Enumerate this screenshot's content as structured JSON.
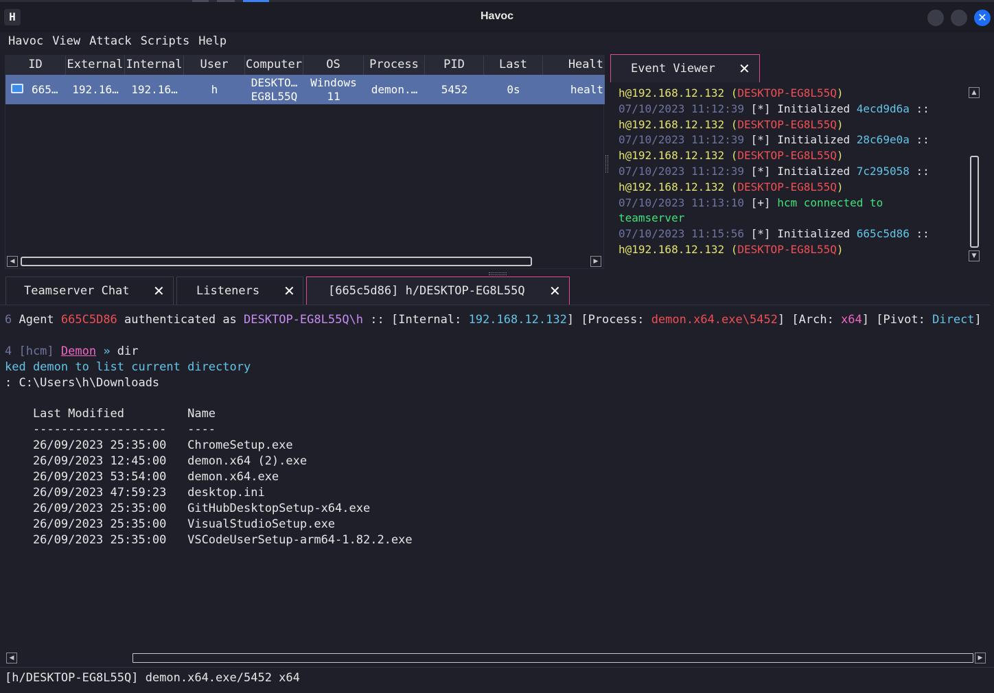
{
  "window": {
    "title": "Havoc",
    "app_icon_glyph": "H"
  },
  "menu": [
    "Havoc",
    "View",
    "Attack",
    "Scripts",
    "Help"
  ],
  "sessions_table": {
    "columns": [
      "ID",
      "External",
      "Internal",
      "User",
      "Computer",
      "OS",
      "Process",
      "PID",
      "Last",
      "Healt"
    ],
    "rows": [
      {
        "id": "665…",
        "external": "192.16…",
        "internal": "192.16…",
        "user": "h",
        "computer_line1": "DESKTO…",
        "computer_line2": "EG8L55Q",
        "os_line1": "Windows",
        "os_line2": "11",
        "process": "demon.…",
        "pid": "5452",
        "last": "0s",
        "health": "healt"
      }
    ],
    "row_selected_color": "#566fa6"
  },
  "event_viewer": {
    "tab_label": "Event Viewer",
    "lines": [
      [
        {
          "t": "h@192.168.12.132 (",
          "c": "y"
        },
        {
          "t": "DESKTOP-EG8L55Q",
          "c": "r"
        },
        {
          "t": ")",
          "c": "y"
        }
      ],
      [
        {
          "t": "07/10/2023 11:12:39 ",
          "c": "g"
        },
        {
          "t": "[*] Initialized ",
          "c": "w"
        },
        {
          "t": "4ecd9d6a",
          "c": "c"
        },
        {
          "t": " ::",
          "c": "w"
        }
      ],
      [
        {
          "t": "h@192.168.12.132 (",
          "c": "y"
        },
        {
          "t": "DESKTOP-EG8L55Q",
          "c": "r"
        },
        {
          "t": ")",
          "c": "y"
        }
      ],
      [
        {
          "t": "07/10/2023 11:12:39 ",
          "c": "g"
        },
        {
          "t": "[*] Initialized ",
          "c": "w"
        },
        {
          "t": "28c69e0a",
          "c": "c"
        },
        {
          "t": " ::",
          "c": "w"
        }
      ],
      [
        {
          "t": "h@192.168.12.132 (",
          "c": "y"
        },
        {
          "t": "DESKTOP-EG8L55Q",
          "c": "r"
        },
        {
          "t": ")",
          "c": "y"
        }
      ],
      [
        {
          "t": "07/10/2023 11:12:39 ",
          "c": "g"
        },
        {
          "t": "[*] Initialized ",
          "c": "w"
        },
        {
          "t": "7c295058",
          "c": "c"
        },
        {
          "t": " ::",
          "c": "w"
        }
      ],
      [
        {
          "t": "h@192.168.12.132 (",
          "c": "y"
        },
        {
          "t": "DESKTOP-EG8L55Q",
          "c": "r"
        },
        {
          "t": ")",
          "c": "y"
        }
      ],
      [
        {
          "t": "07/10/2023 11:13:10 ",
          "c": "g"
        },
        {
          "t": "[+] ",
          "c": "w"
        },
        {
          "t": "hcm connected to",
          "c": "gr"
        }
      ],
      [
        {
          "t": "teamserver",
          "c": "gr"
        }
      ],
      [
        {
          "t": "07/10/2023 11:15:56 ",
          "c": "g"
        },
        {
          "t": "[*] Initialized ",
          "c": "w"
        },
        {
          "t": "665c5d86",
          "c": "c"
        },
        {
          "t": " ::",
          "c": "w"
        }
      ],
      [
        {
          "t": "h@192.168.12.132 (",
          "c": "y"
        },
        {
          "t": "DESKTOP-EG8L55Q",
          "c": "r"
        },
        {
          "t": ")",
          "c": "y"
        }
      ]
    ]
  },
  "console_tabs": [
    {
      "label": "Teamserver Chat",
      "active": false
    },
    {
      "label": "Listeners",
      "active": false
    },
    {
      "label": "[665c5d86] h/DESKTOP-EG8L55Q",
      "active": true
    }
  ],
  "console": {
    "lines": [
      [
        {
          "t": "6 ",
          "c": "g"
        },
        {
          "t": "Agent ",
          "c": "w"
        },
        {
          "t": "665C5D86",
          "c": "r"
        },
        {
          "t": " authenticated as ",
          "c": "w"
        },
        {
          "t": "DESKTOP-EG8L55Q\\h",
          "c": "p"
        },
        {
          "t": " :: [Internal: ",
          "c": "w"
        },
        {
          "t": "192.168.12.132",
          "c": "c"
        },
        {
          "t": "] [Process: ",
          "c": "w"
        },
        {
          "t": "demon.x64.exe\\5452",
          "c": "r"
        },
        {
          "t": "] [Arch: ",
          "c": "w"
        },
        {
          "t": "x64",
          "c": "pk"
        },
        {
          "t": "] [Pivot: ",
          "c": "w"
        },
        {
          "t": "Direct",
          "c": "c"
        },
        {
          "t": "]",
          "c": "w"
        }
      ],
      [],
      [
        {
          "t": "4 [hcm] ",
          "c": "g"
        },
        {
          "t": "Demon",
          "c": "pk",
          "u": true
        },
        {
          "t": " » ",
          "c": "c"
        },
        {
          "t": "dir",
          "c": "w"
        }
      ],
      [
        {
          "t": "ked demon to list current directory",
          "c": "c"
        }
      ],
      [
        {
          "t": ": C:\\Users\\h\\Downloads",
          "c": "w"
        }
      ],
      [],
      [
        {
          "t": "    Last Modified         Name",
          "c": "w"
        }
      ],
      [
        {
          "t": "    -------------------   ----",
          "c": "w"
        }
      ],
      [
        {
          "t": "    26/09/2023 25:35:00   ChromeSetup.exe",
          "c": "w"
        }
      ],
      [
        {
          "t": "    26/09/2023 12:45:00   demon.x64 (2).exe",
          "c": "w"
        }
      ],
      [
        {
          "t": "    26/09/2023 53:54:00   demon.x64.exe",
          "c": "w"
        }
      ],
      [
        {
          "t": "    26/09/2023 47:59:23   desktop.ini",
          "c": "w"
        }
      ],
      [
        {
          "t": "    26/09/2023 25:35:00   GitHubDesktopSetup-x64.exe",
          "c": "w"
        }
      ],
      [
        {
          "t": "    26/09/2023 25:35:00   VisualStudioSetup.exe",
          "c": "w"
        }
      ],
      [
        {
          "t": "    26/09/2023 25:35:00   VSCodeUserSetup-arm64-1.82.2.exe",
          "c": "w"
        }
      ]
    ]
  },
  "status_bar": {
    "text": "[h/DESKTOP-EG8L55Q] demon.x64.exe/5452 x64"
  },
  "icons": {
    "close": "close-icon",
    "agent": "computer-icon"
  },
  "colors": {
    "accent_tab": "#e24a8e",
    "close_window": "#1e6ef5",
    "background": "#1e1f29"
  }
}
